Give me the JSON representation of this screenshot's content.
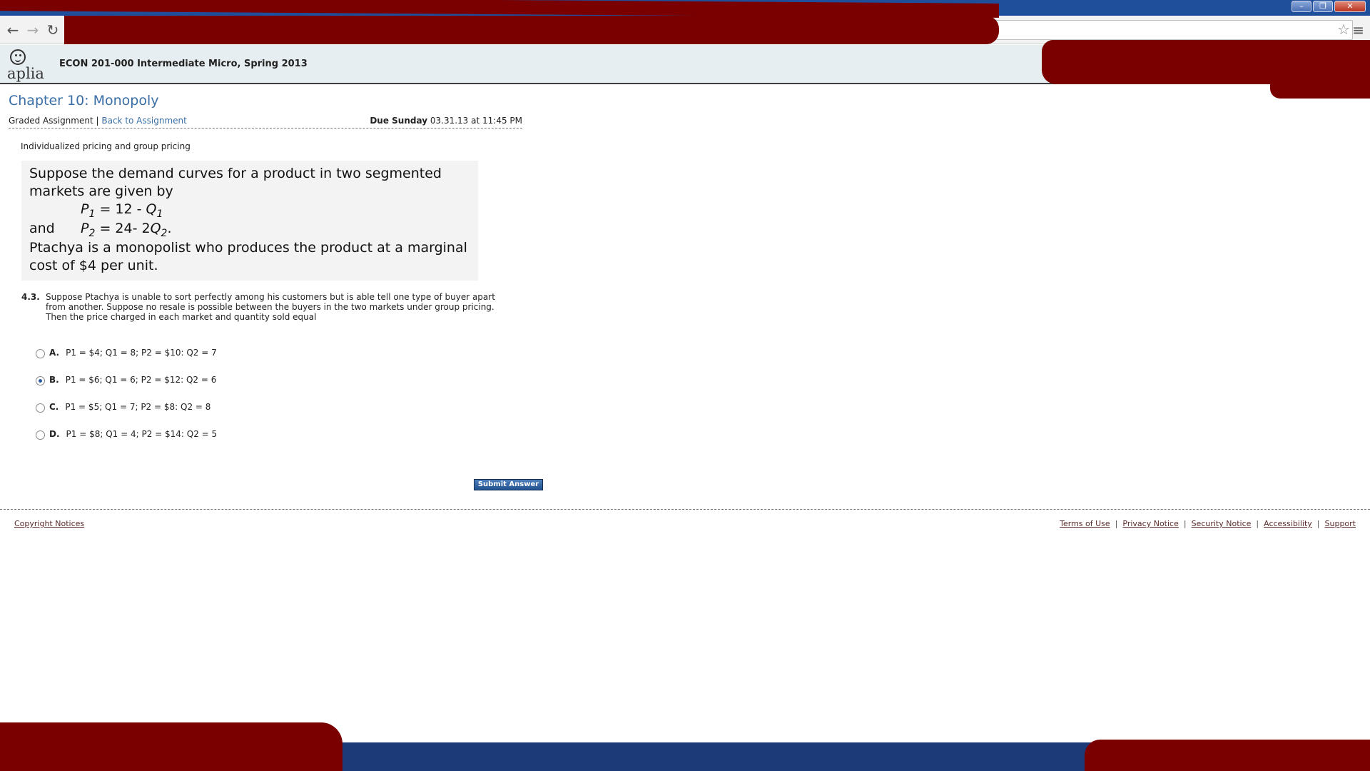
{
  "browser": {
    "nav": {
      "back": "←",
      "forward": "→",
      "reload": "↻"
    },
    "star_icon": "☆",
    "menu_icon": "≡",
    "window_controls": [
      "–",
      "❐",
      "✕"
    ]
  },
  "app": {
    "logo_text": "aplia",
    "course_title": "ECON 201-000 Intermediate Micro, Spring 2013"
  },
  "page": {
    "chapter_title": "Chapter 10: Monopoly",
    "assignment_type": "Graded Assignment",
    "separator": "|",
    "back_link": "Back to Assignment",
    "due_label": "Due Sunday",
    "due_value": "03.31.13 at 11:45 PM",
    "topic": "Individualized pricing and group pricing"
  },
  "scenario": {
    "intro": "Suppose the demand curves for a product in two segmented markets are given by",
    "eq1": {
      "lhs": "P",
      "lhs_sub": "1",
      "rhs": "= 12 - ",
      "rhs_var": "Q",
      "rhs_sub": "1"
    },
    "and_word": "and",
    "eq2": {
      "lhs": "P",
      "lhs_sub": "2",
      "rhs": "= 24- 2",
      "rhs_var": "Q",
      "rhs_sub": "2",
      "tail": "."
    },
    "outro": "Ptachya is a monopolist who produces the product at a marginal cost of $4 per unit."
  },
  "question": {
    "number": "4.3.",
    "text": "Suppose Ptachya is unable to sort perfectly among his customers but is able tell one type of buyer apart from another. Suppose no resale is possible between the buyers in the two markets under group pricing. Then the price charged in each market and quantity sold equal",
    "options": [
      {
        "letter": "A.",
        "text": "P1 = $4; Q1 = 8; P2 = $10: Q2 = 7",
        "selected": false
      },
      {
        "letter": "B.",
        "text": "P1 = $6; Q1 = 6; P2 = $12: Q2 = 6",
        "selected": true
      },
      {
        "letter": "C.",
        "text": "P1 = $5; Q1 = 7; P2 = $8: Q2 = 8",
        "selected": false
      },
      {
        "letter": "D.",
        "text": "P1 = $8; Q1 = 4; P2 = $14: Q2 = 5",
        "selected": false
      }
    ],
    "submit_label": "Submit Answer"
  },
  "footer": {
    "copyright": "Copyright Notices",
    "links": [
      "Terms of Use",
      "Privacy Notice",
      "Security Notice",
      "Accessibility",
      "Support"
    ]
  },
  "colors": {
    "accent": "#3a6ea5",
    "redaction": "#7a0000",
    "titlebar": "#1f4e9a"
  }
}
